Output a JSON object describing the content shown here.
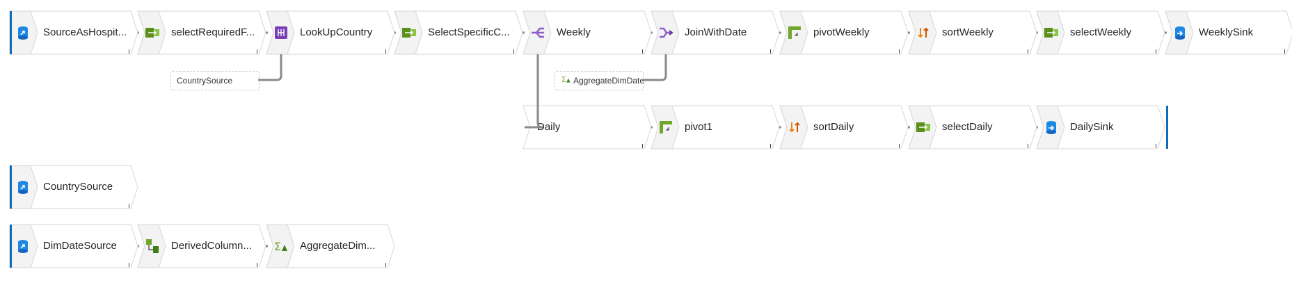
{
  "colors": {
    "accent": "#0f6cbd",
    "link": "#8a8a8a",
    "tile": "#f3f3f3",
    "border": "#d6d6d6"
  },
  "nodes": [
    {
      "id": "n1",
      "label": "SourceAsHospit...",
      "icon": "source-icon"
    },
    {
      "id": "n2",
      "label": "selectRequiredF...",
      "icon": "select-icon"
    },
    {
      "id": "n3",
      "label": "LookUpCountry",
      "icon": "lookup-icon"
    },
    {
      "id": "n4",
      "label": "SelectSpecificC...",
      "icon": "select-icon"
    },
    {
      "id": "n5",
      "label": "Weekly",
      "icon": "split-icon"
    },
    {
      "id": "n6",
      "label": "JoinWithDate",
      "icon": "join-icon"
    },
    {
      "id": "n7",
      "label": "pivotWeekly",
      "icon": "pivot-icon"
    },
    {
      "id": "n8",
      "label": "sortWeekly",
      "icon": "sort-icon"
    },
    {
      "id": "n9",
      "label": "selectWeekly",
      "icon": "select-icon"
    },
    {
      "id": "n10",
      "label": "WeeklySink",
      "icon": "sink-icon"
    },
    {
      "id": "n11",
      "label": "Daily",
      "icon": ""
    },
    {
      "id": "n12",
      "label": "pivot1",
      "icon": "pivot-icon"
    },
    {
      "id": "n13",
      "label": "sortDaily",
      "icon": "sort-icon"
    },
    {
      "id": "n14",
      "label": "selectDaily",
      "icon": "select-icon"
    },
    {
      "id": "n15",
      "label": "DailySink",
      "icon": "sink-icon"
    },
    {
      "id": "n16",
      "label": "CountrySource",
      "icon": "source-icon"
    },
    {
      "id": "n17",
      "label": "DimDateSource",
      "icon": "source-icon"
    },
    {
      "id": "n18",
      "label": "DerivedColumn...",
      "icon": "derived-column-icon"
    },
    {
      "id": "n19",
      "label": "AggregateDim...",
      "icon": "aggregate-icon"
    }
  ],
  "refs": [
    {
      "id": "r1",
      "label": "CountrySource",
      "icon": ""
    },
    {
      "id": "r2",
      "label": "AggregateDimDate",
      "icon": "aggregate-icon"
    }
  ],
  "links": [
    [
      "n1",
      "n2"
    ],
    [
      "n2",
      "n3"
    ],
    [
      "n3",
      "n4"
    ],
    [
      "n4",
      "n5"
    ],
    [
      "n5",
      "n6"
    ],
    [
      "n6",
      "n7"
    ],
    [
      "n7",
      "n8"
    ],
    [
      "n8",
      "n9"
    ],
    [
      "n9",
      "n10"
    ],
    [
      "n5",
      "n11"
    ],
    [
      "n11",
      "n12"
    ],
    [
      "n12",
      "n13"
    ],
    [
      "n13",
      "n14"
    ],
    [
      "n14",
      "n15"
    ],
    [
      "n17",
      "n18"
    ],
    [
      "n18",
      "n19"
    ],
    [
      "r1",
      "n3"
    ],
    [
      "r2",
      "n6"
    ]
  ]
}
